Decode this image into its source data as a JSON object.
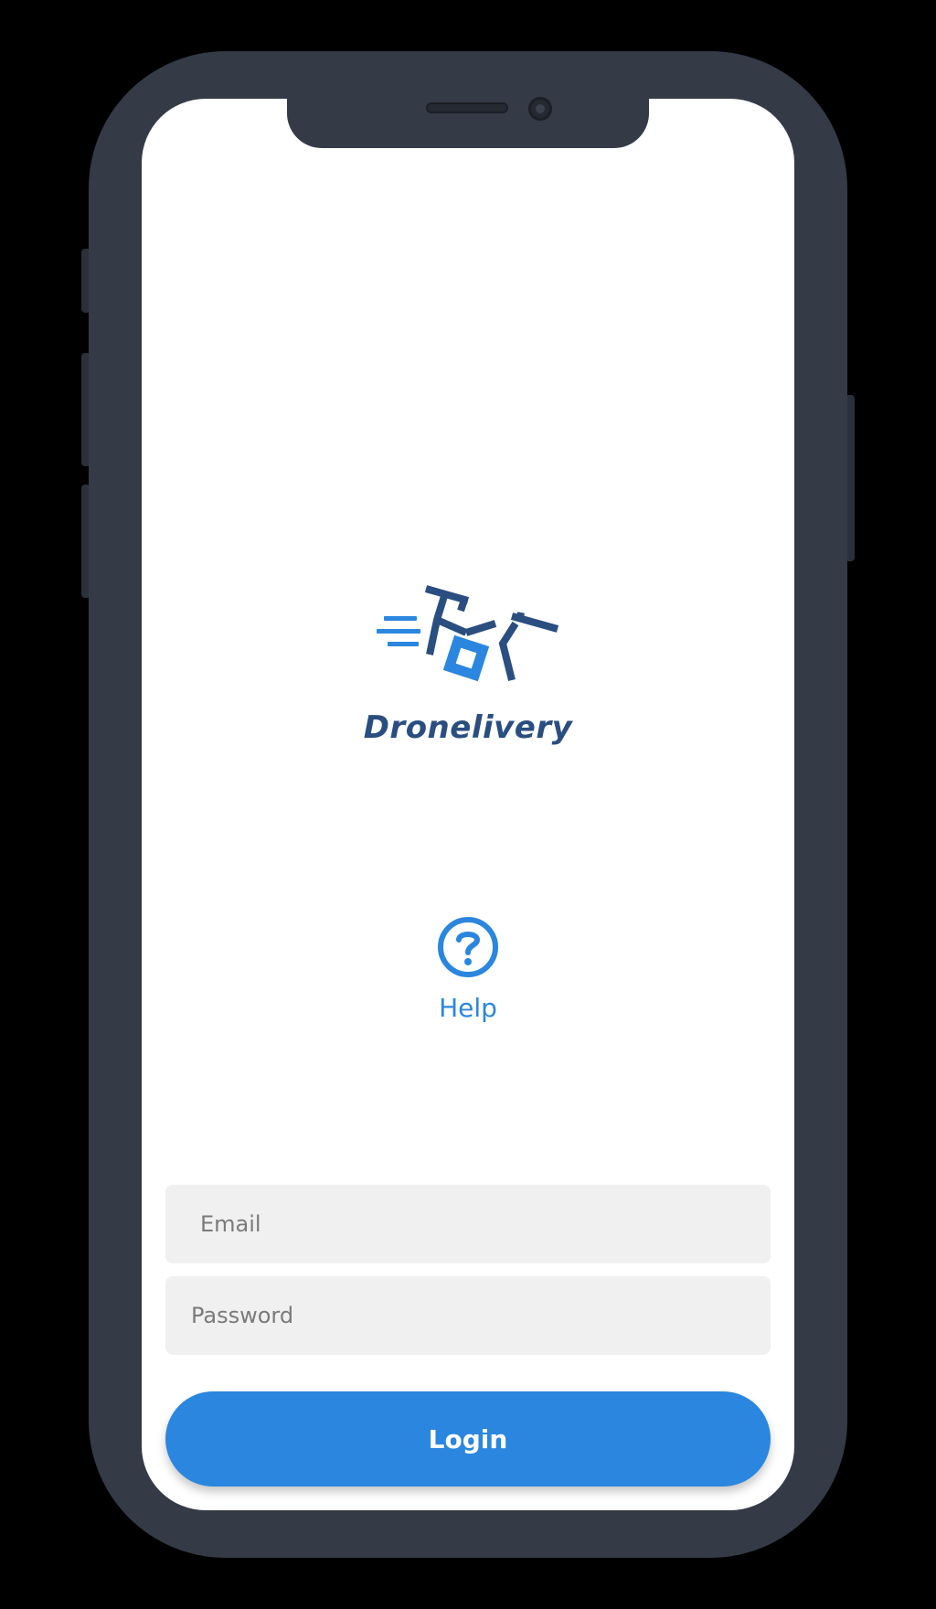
{
  "app": {
    "brand_name": "Dronelivery",
    "logo_icon": "drone-delivery-icon",
    "colors": {
      "brand_dark": "#2a4e80",
      "accent": "#2a86de",
      "field_bg": "#f0f0f0",
      "device_frame": "#343b47"
    }
  },
  "help": {
    "icon": "question-circle-icon",
    "label": "Help"
  },
  "form": {
    "email_placeholder": "Email",
    "password_placeholder": "Password",
    "login_label": "Login"
  }
}
